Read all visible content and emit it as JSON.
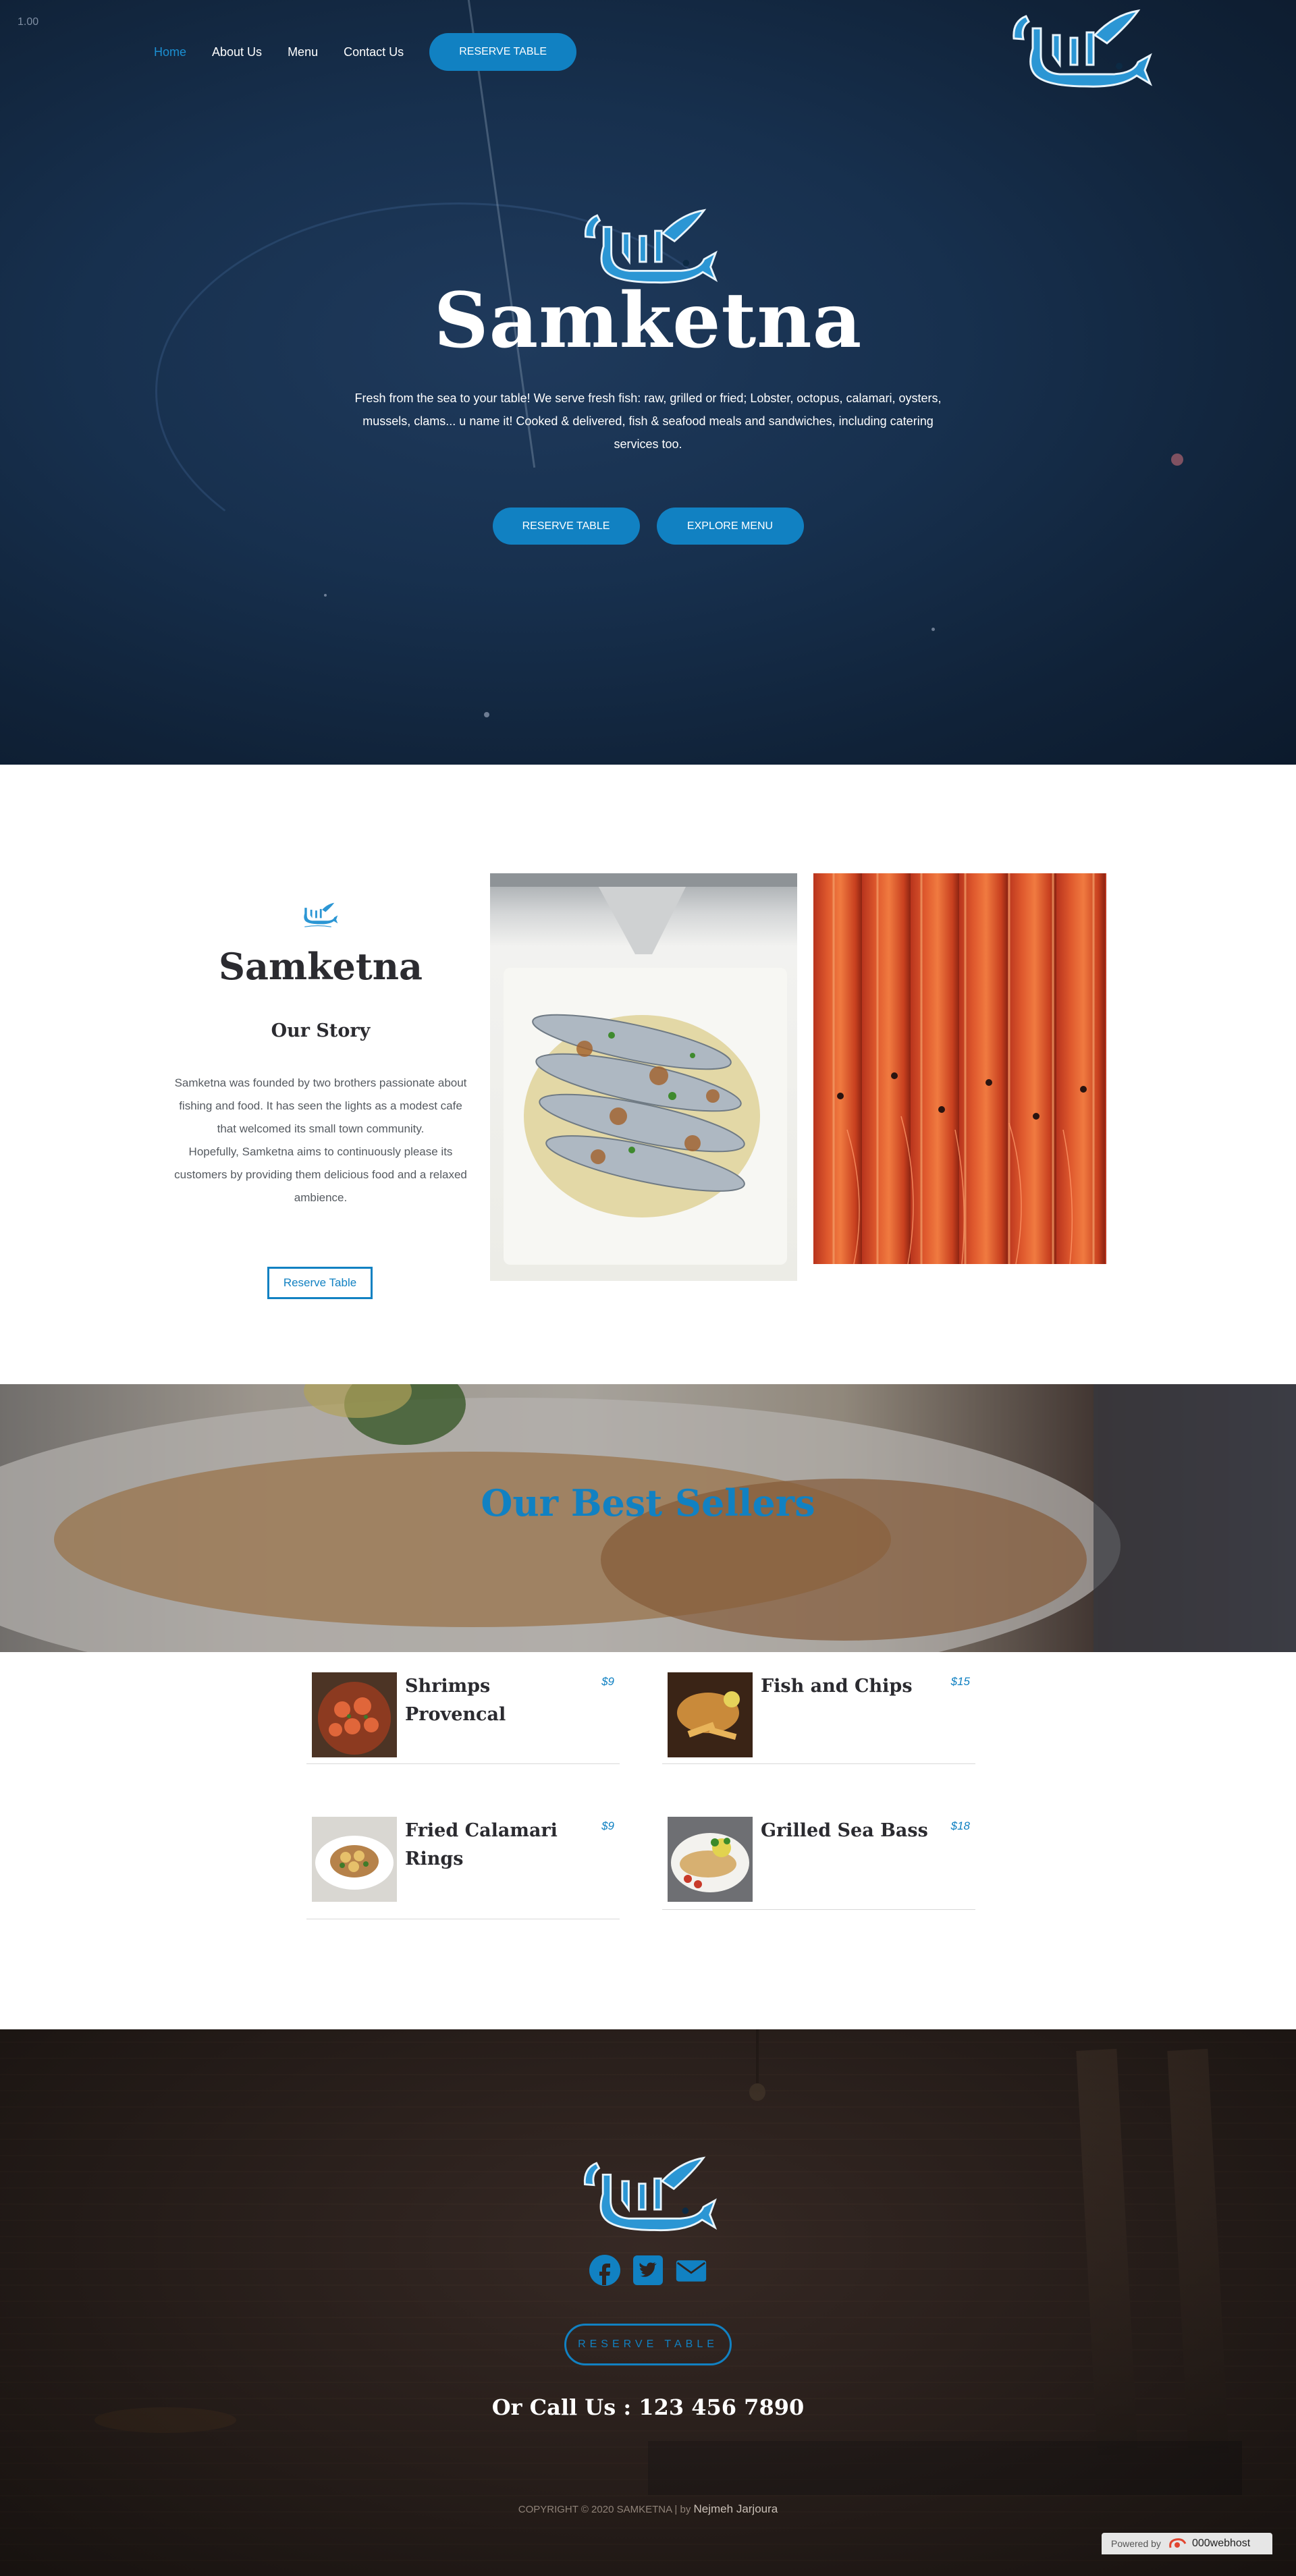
{
  "version_badge": "1.00",
  "nav": {
    "items": [
      "Home",
      "About Us",
      "Menu",
      "Contact Us"
    ],
    "active": "Home",
    "cta": "RESERVE TABLE"
  },
  "hero": {
    "title": "Samketna",
    "text": "Fresh from the sea to your table! We serve fresh fish: raw, grilled or fried; Lobster, octopus, calamari, oysters, mussels, clams... u name it! Cooked & delivered, fish & seafood meals and sandwiches, including catering services too.",
    "buttons": [
      "RESERVE TABLE",
      "EXPLORE MENU"
    ]
  },
  "story": {
    "title": "Samketna",
    "subtitle": "Our Story",
    "paragraph1": "Samketna was founded by two brothers passionate about fishing and food. It has seen the lights as a modest cafe that welcomed its small town community.",
    "paragraph2": "Hopefully, Samketna aims to continuously please its customers by providing them delicious food and a relaxed ambience.",
    "button": "Reserve Table"
  },
  "best_sellers": {
    "title": "Our Best Sellers",
    "items": [
      {
        "name": "Shrimps Provencal",
        "price": "$9"
      },
      {
        "name": "Fish and Chips",
        "price": "$15"
      },
      {
        "name": "Fried Calamari Rings",
        "price": "$9"
      },
      {
        "name": "Grilled Sea Bass",
        "price": "$18"
      }
    ]
  },
  "footer": {
    "social_icons": [
      "facebook-icon",
      "twitter-icon",
      "envelope-icon"
    ],
    "button": "RESERVE TABLE",
    "call": "Or Call Us : 123 456 7890",
    "copyright": "COPYRIGHT © 2020 SAMKETNA | by",
    "author": "Nejmeh Jarjoura",
    "powered_label": "Powered by",
    "powered_brand": "000webhost"
  },
  "colors": {
    "accent": "#1181c2",
    "hero_bg": "#17304e",
    "footer_bg": "#2f2420"
  }
}
